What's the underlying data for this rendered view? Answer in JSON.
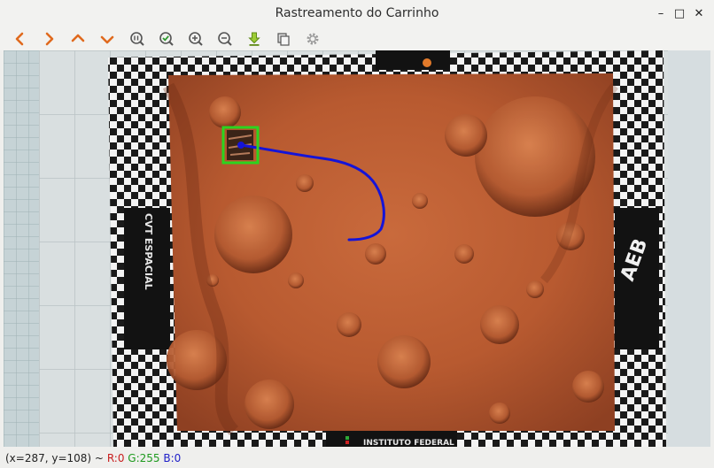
{
  "window": {
    "title": "Rastreamento do Carrinho"
  },
  "window_controls": {
    "minimize": "–",
    "maximize": "□",
    "close": "✕"
  },
  "toolbar": {
    "items": [
      {
        "name": "pan-left",
        "icon": "chevron-left-icon"
      },
      {
        "name": "pan-right",
        "icon": "chevron-right-icon"
      },
      {
        "name": "pan-up",
        "icon": "chevron-up-icon"
      },
      {
        "name": "pan-down",
        "icon": "chevron-down-icon"
      },
      {
        "name": "zoom-original",
        "icon": "zoom-reset-icon"
      },
      {
        "name": "zoom-fit",
        "icon": "zoom-fit-icon"
      },
      {
        "name": "zoom-in",
        "icon": "zoom-in-icon"
      },
      {
        "name": "zoom-out",
        "icon": "zoom-out-icon"
      },
      {
        "name": "save-image",
        "icon": "download-icon"
      },
      {
        "name": "copy-image",
        "icon": "copy-icon"
      },
      {
        "name": "properties",
        "icon": "gear-icon"
      }
    ]
  },
  "image": {
    "left_panel_text": "CVT ESPACIAL",
    "right_panel_text": "AEB",
    "bottom_panel_text": "INSTITUTO FEDERAL",
    "tracking_box_color": "#2bd41f",
    "trajectory_color": "#1414d8"
  },
  "status": {
    "coords": "(x=287, y=108) ~",
    "r": "R:0",
    "g": "G:255",
    "b": "B:0",
    "r_color": "#c81e1e",
    "g_color": "#1e9a1e",
    "b_color": "#1e1ec8"
  }
}
